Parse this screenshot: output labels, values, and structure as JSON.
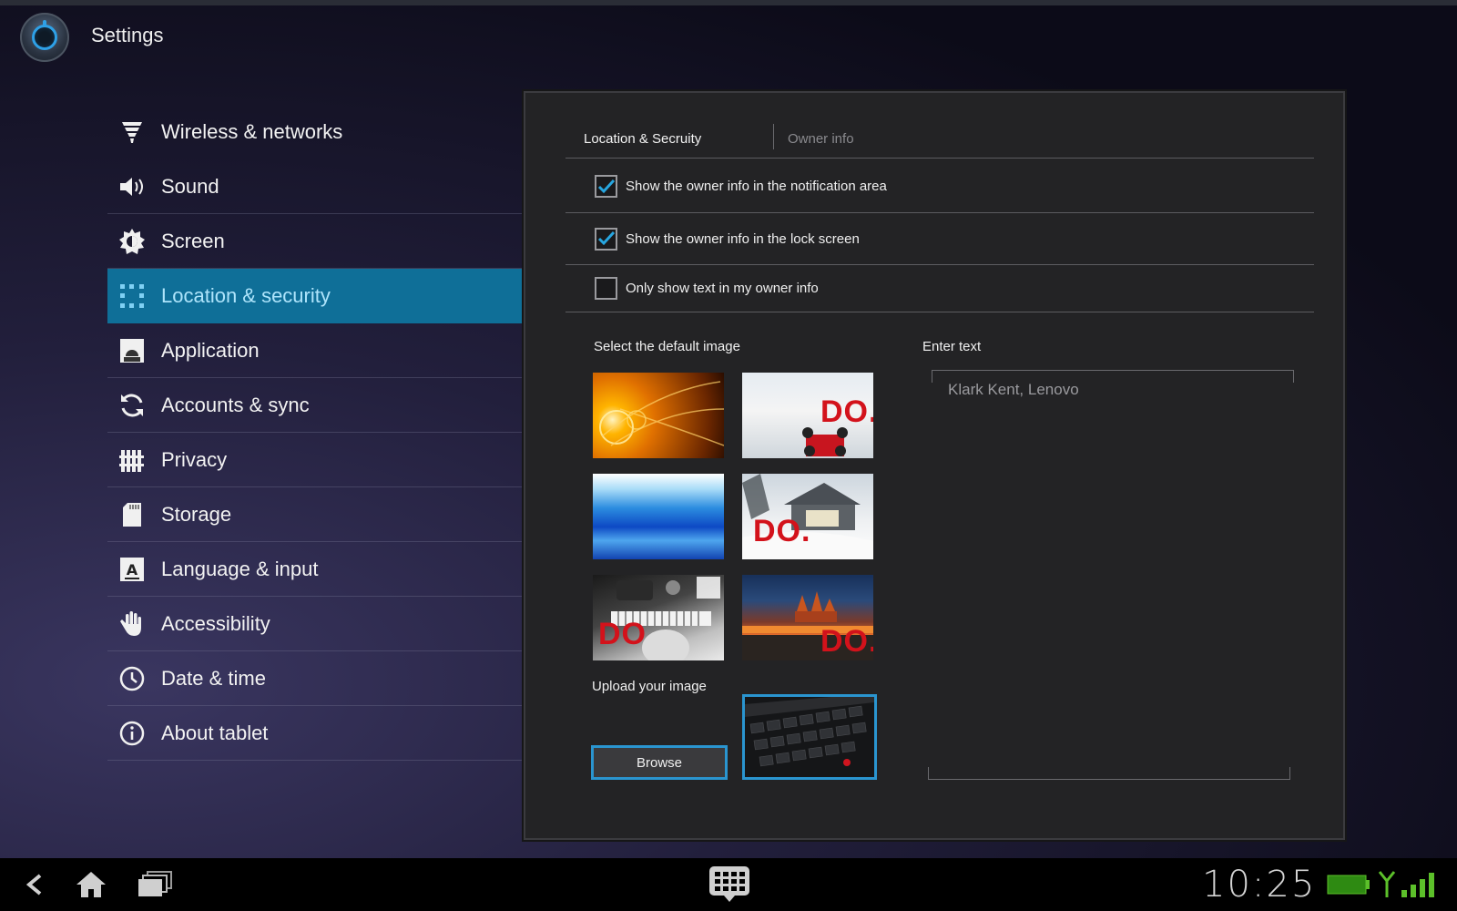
{
  "app": {
    "title": "Settings"
  },
  "sidebar": {
    "items": [
      {
        "label": "Wireless & networks",
        "icon": "wireless-icon"
      },
      {
        "label": "Sound",
        "icon": "speaker-icon"
      },
      {
        "label": "Screen",
        "icon": "brightness-icon"
      },
      {
        "label": "Location & security",
        "icon": "location-grid-icon",
        "active": true
      },
      {
        "label": "Application",
        "icon": "android-icon"
      },
      {
        "label": "Accounts & sync",
        "icon": "sync-icon"
      },
      {
        "label": "Privacy",
        "icon": "privacy-fence-icon"
      },
      {
        "label": "Storage",
        "icon": "sd-card-icon"
      },
      {
        "label": "Language & input",
        "icon": "language-a-icon"
      },
      {
        "label": "Accessibility",
        "icon": "hand-icon"
      },
      {
        "label": "Date & time",
        "icon": "clock-icon"
      },
      {
        "label": "About tablet",
        "icon": "info-icon"
      }
    ]
  },
  "panel": {
    "tabs": [
      {
        "label": "Location & Secruity"
      },
      {
        "label": "Owner info"
      }
    ],
    "options": [
      {
        "label": "Show the owner info in the notification area",
        "checked": true
      },
      {
        "label": "Show the owner info in the lock screen",
        "checked": true
      },
      {
        "label": "Only show text in my owner info",
        "checked": false
      }
    ],
    "default_image_label": "Select the default image",
    "images": [
      {
        "name": "orange-light-burst",
        "overlay": ""
      },
      {
        "name": "snow-rc-car",
        "overlay": "DO."
      },
      {
        "name": "blue-waves",
        "overlay": ""
      },
      {
        "name": "snow-house",
        "overlay": "DO."
      },
      {
        "name": "dj-piano",
        "overlay": "DO"
      },
      {
        "name": "red-square-crowd",
        "overlay": "DO."
      }
    ],
    "upload_label": "Upload your image",
    "browse_label": "Browse",
    "enter_text_label": "Enter text",
    "enter_text_value": "Klark Kent, Lenovo"
  },
  "system_bar": {
    "time": "10:25",
    "icons": [
      "back-icon",
      "home-icon",
      "recent-apps-icon",
      "app-drawer-icon",
      "battery-icon",
      "signal-icon"
    ]
  },
  "colors": {
    "accent": "#2a95d0",
    "active_item": "#0f6f98",
    "do_red": "#d3121b"
  }
}
